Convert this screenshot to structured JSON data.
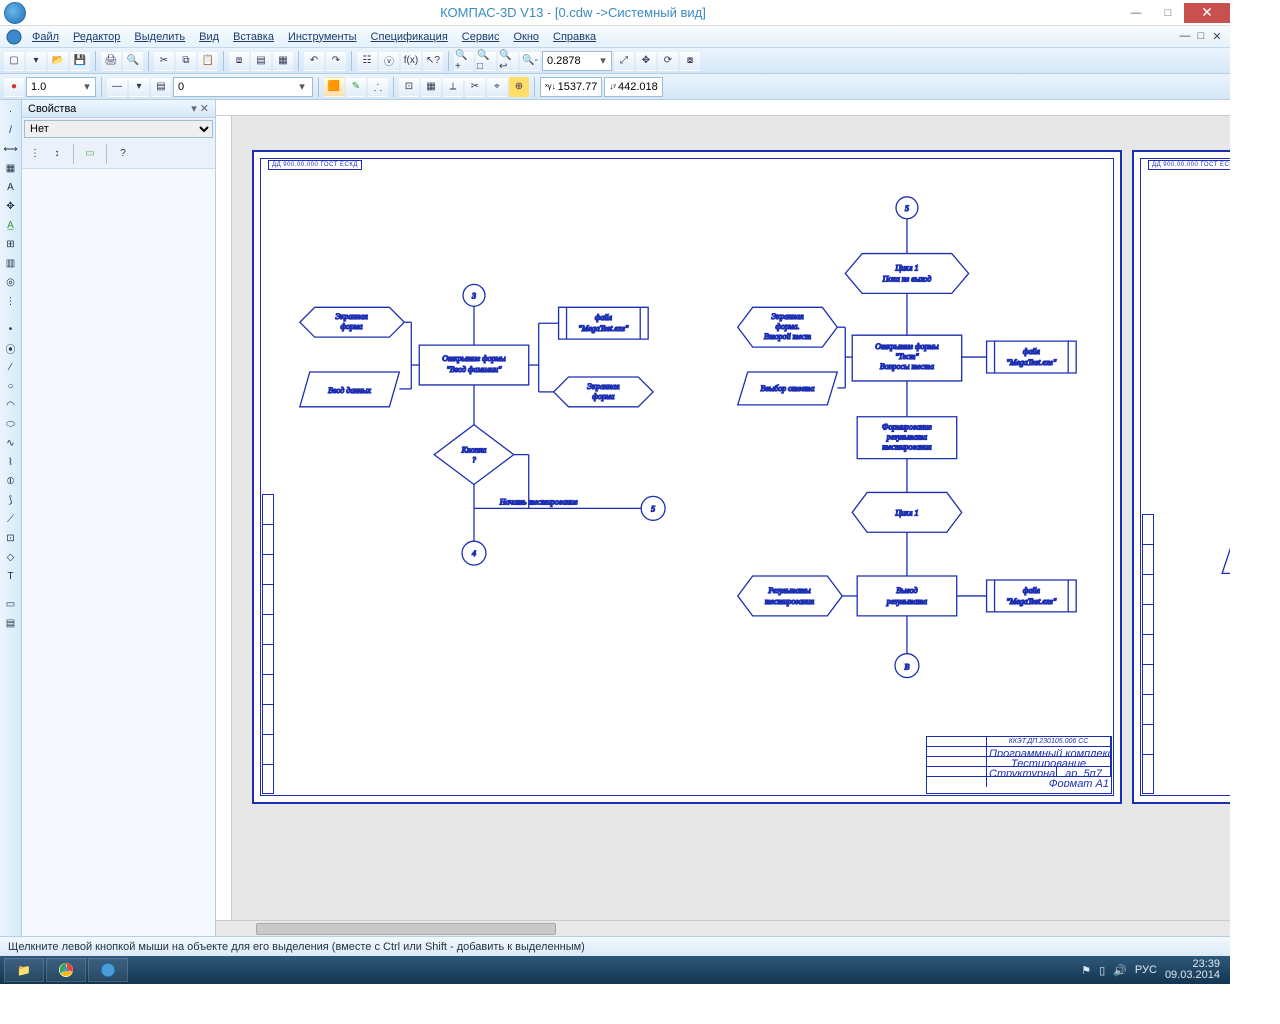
{
  "title": "КОМПАС-3D V13 - [0.cdw ->Системный вид]",
  "menu": [
    "Файл",
    "Редактор",
    "Выделить",
    "Вид",
    "Вставка",
    "Инструменты",
    "Спецификация",
    "Сервис",
    "Окно",
    "Справка"
  ],
  "toolbar2": {
    "scale": "1.0",
    "layer": "0",
    "zoom": "0.2878",
    "coordX": "1537.77",
    "coordY": "442.018"
  },
  "props": {
    "title": "Свойства",
    "pin": "▾ ✕",
    "select": "Нет"
  },
  "status": "Щелкните левой кнопкой мыши на объекте для его выделения (вместе с Ctrl или Shift - добавить к выделенным)",
  "tray": {
    "lang": "РУС",
    "time": "23:39",
    "date": "09.03.2014"
  },
  "frame_id": "ДД 900.00.000 ГОСТ ЕСКД",
  "titleblock": {
    "code": "ККЭТ.ДП.230105.006 СС",
    "a": "Программный комплекс",
    "b": "Тестирование",
    "c": "Структурная схема",
    "d": "ар. 5п7",
    "format": "Формат A1"
  },
  "fc": {
    "conn3": "3",
    "conn5a": "5",
    "conn5b": "5",
    "connB": "В",
    "screen_form": "Экранная\nформа",
    "data_entry": "Ввод данных",
    "open_form": "Открытие формы\n\"Ввод фамилии\"",
    "file_mega": "файл\n\"MegaTest.exe\"",
    "knopka": "Кнопка\n?",
    "start_test": "Начать тестирование",
    "conn4": "4",
    "cycle1_start": "Цикл 1\nПока не выход",
    "screen_form2": "Экранная\nформа.\nВторой тест",
    "open_test": "Открытие формы\n\"Тест\"\nВопросы теста",
    "choose_ans": "Ввыбор ответа",
    "form_result": "Формирование\nрезультата\nтестирования",
    "cycle1_end": "Цикл 1",
    "results": "Результаты\nтестирования",
    "out_result": "Вывод\nрезультата"
  }
}
